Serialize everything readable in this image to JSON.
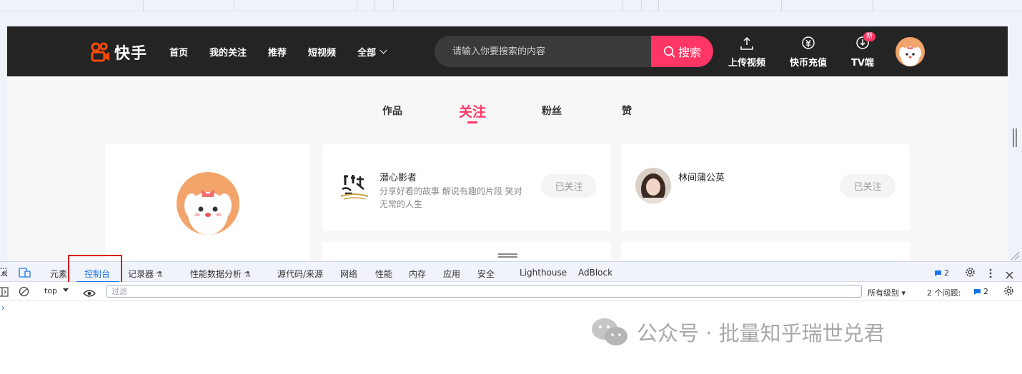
{
  "site": {
    "logo_text": "快手",
    "nav": [
      {
        "label": "首页"
      },
      {
        "label": "我的关注"
      },
      {
        "label": "推荐"
      },
      {
        "label": "短视频"
      },
      {
        "label": "全部"
      }
    ],
    "search_placeholder": "请输入你要搜索的内容",
    "search_button": "搜索",
    "actions": [
      {
        "label": "上传视频",
        "icon": "upload-icon"
      },
      {
        "label": "快币充值",
        "icon": "coin-icon"
      },
      {
        "label": "TV端",
        "icon": "tv-download-icon",
        "badge": "新"
      }
    ],
    "accent_color": "#fe3666"
  },
  "profile_tabs": [
    {
      "label": "作品",
      "active": false
    },
    {
      "label": "关注",
      "active": true
    },
    {
      "label": "粉丝",
      "active": false
    },
    {
      "label": "赞",
      "active": false
    }
  ],
  "follow_list": [
    {
      "name": "潜心影者",
      "desc": "分享好看的故事 解说有趣的片段 笑对无常的人生",
      "button": "已关注"
    },
    {
      "name": "林间蒲公英",
      "desc": "",
      "button": "已关注"
    }
  ],
  "devtools": {
    "tabs": [
      {
        "label": "元素"
      },
      {
        "label": "控制台",
        "active": true
      },
      {
        "label": "记录器"
      },
      {
        "label": "性能数据分析"
      },
      {
        "label": "源代码/来源"
      },
      {
        "label": "网络"
      },
      {
        "label": "性能"
      },
      {
        "label": "内存"
      },
      {
        "label": "应用"
      },
      {
        "label": "安全"
      },
      {
        "label": "Lighthouse"
      },
      {
        "label": "AdBlock"
      }
    ],
    "messages_count": "2",
    "context": "top",
    "filter_placeholder": "过滤",
    "levels": "所有级别",
    "issues_label": "2 个问题:",
    "issues_count": "2",
    "prompt": "›"
  },
  "watermark": "公众号 · 批量知乎瑞世兑君"
}
